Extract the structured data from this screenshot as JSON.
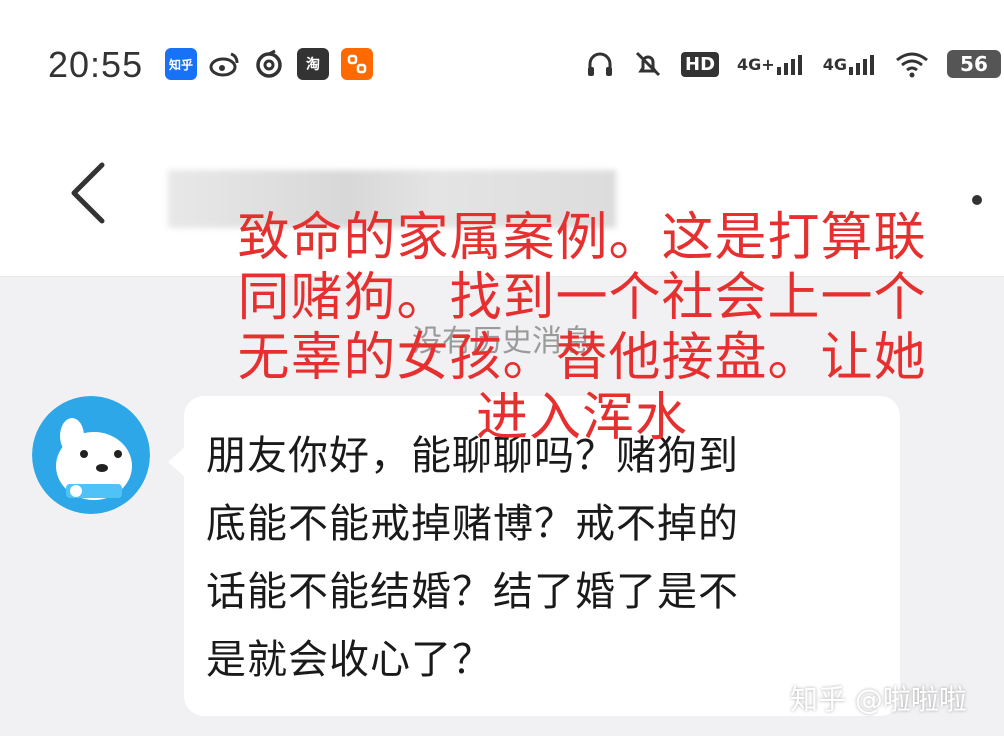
{
  "status_bar": {
    "time": "20:55",
    "app_icons": [
      {
        "name": "zhihu-icon",
        "label": "知乎",
        "color": "#1772f6"
      },
      {
        "name": "weibo-icon",
        "label": "",
        "color": "#333333"
      },
      {
        "name": "netease-music-icon",
        "label": "",
        "color": "#333333"
      },
      {
        "name": "taobao-icon",
        "label": "淘",
        "color": "#333333"
      },
      {
        "name": "meituan-icon",
        "label": "",
        "color": "#ff6a00"
      }
    ],
    "signal_hd": "HD",
    "network_1": "4G+",
    "network_2": "4G",
    "battery": "56"
  },
  "nav": {
    "title_redacted": true
  },
  "chat": {
    "no_history_text": "没有历史消息",
    "message_lines": [
      "朋友你好，能聊聊吗？赌狗到",
      "底能不能戒掉赌博？戒不掉的",
      "话能不能结婚？结了婚了是不",
      "是就会收心了？"
    ]
  },
  "annotation": {
    "lines": [
      "致命的家属案例。这是打算联",
      "同赌狗。找到一个社会上一个",
      "无辜的女孩。替他接盘。让她",
      "进入浑水"
    ],
    "color": "#e63030"
  },
  "watermark": "知乎 @啦啦啦"
}
